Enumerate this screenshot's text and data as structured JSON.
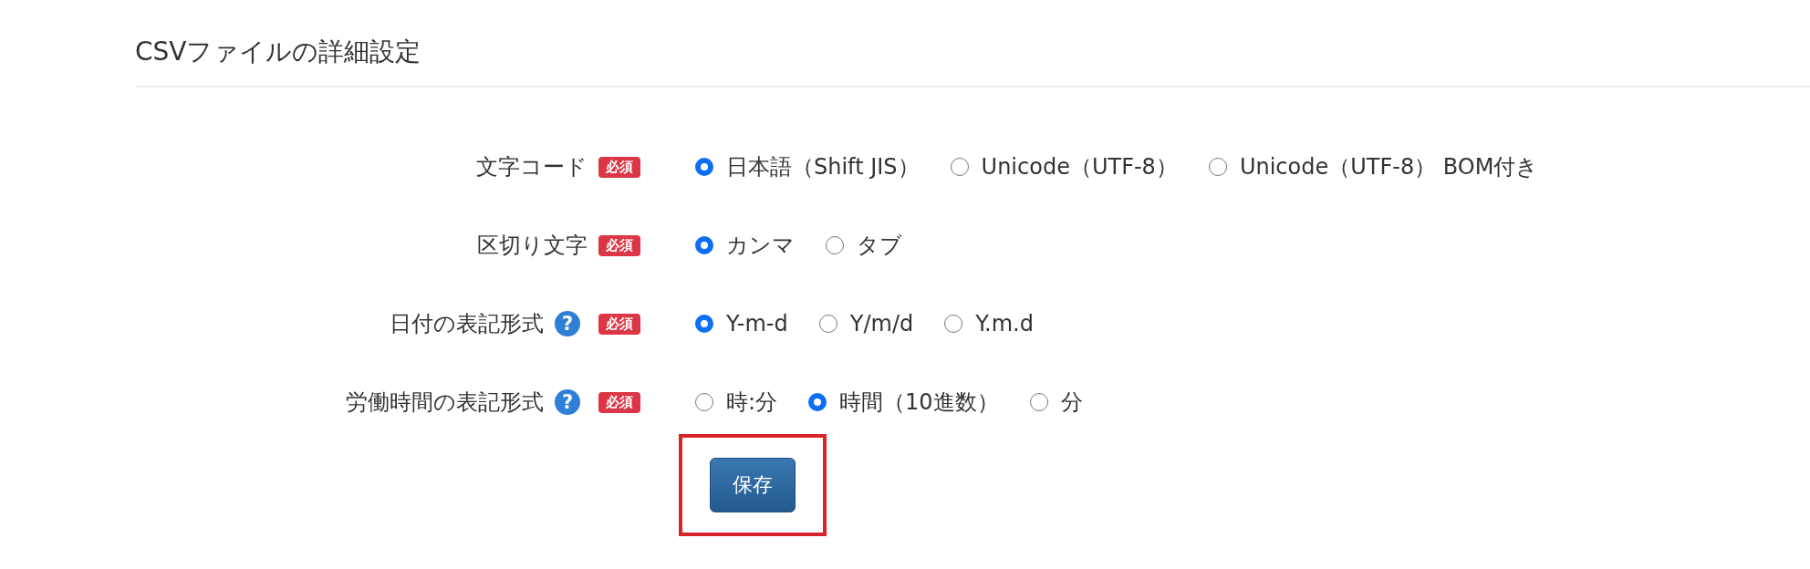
{
  "section": {
    "title": "CSVファイルの詳細設定"
  },
  "fields": [
    {
      "label": "文字コード",
      "required_badge": "必須",
      "options": [
        {
          "label": "日本語（Shift JIS）",
          "selected": true
        },
        {
          "label": "Unicode（UTF-8）",
          "selected": false
        },
        {
          "label": "Unicode（UTF-8） BOM付き",
          "selected": false
        }
      ]
    },
    {
      "label": "区切り文字",
      "required_badge": "必須",
      "options": [
        {
          "label": "カンマ",
          "selected": true
        },
        {
          "label": "タブ",
          "selected": false
        }
      ]
    },
    {
      "label": "日付の表記形式",
      "help": "?",
      "required_badge": "必須",
      "options": [
        {
          "label": "Y-m-d",
          "selected": true
        },
        {
          "label": "Y/m/d",
          "selected": false
        },
        {
          "label": "Y.m.d",
          "selected": false
        }
      ]
    },
    {
      "label": "労働時間の表記形式",
      "help": "?",
      "required_badge": "必須",
      "options": [
        {
          "label": "時:分",
          "selected": false
        },
        {
          "label": "時間（10進数）",
          "selected": true
        },
        {
          "label": "分",
          "selected": false
        }
      ]
    }
  ],
  "save_button": {
    "label": "保存",
    "highlighted": true
  }
}
